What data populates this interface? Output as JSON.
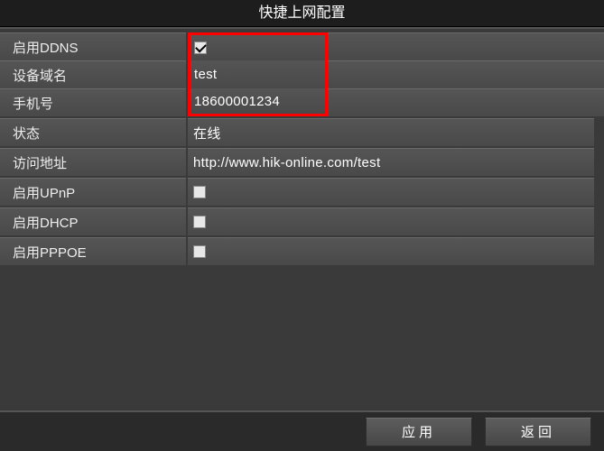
{
  "title": "快捷上网配置",
  "rows": [
    {
      "label": "启用DDNS",
      "type": "checkbox",
      "checked": true,
      "highlight": true
    },
    {
      "label": "设备域名",
      "type": "text",
      "value": "test",
      "highlight": true
    },
    {
      "label": "手机号",
      "type": "text",
      "value": "18600001234",
      "highlight": true
    },
    {
      "label": "状态",
      "type": "text",
      "value": "在线",
      "highlight": false
    },
    {
      "label": "访问地址",
      "type": "text",
      "value": "http://www.hik-online.com/test",
      "highlight": false
    },
    {
      "label": "启用UPnP",
      "type": "checkbox",
      "checked": false,
      "highlight": false
    },
    {
      "label": "启用DHCP",
      "type": "checkbox",
      "checked": false,
      "highlight": false
    },
    {
      "label": "启用PPPOE",
      "type": "checkbox",
      "checked": false,
      "highlight": false
    }
  ],
  "buttons": {
    "apply": "应用",
    "back": "返回"
  }
}
